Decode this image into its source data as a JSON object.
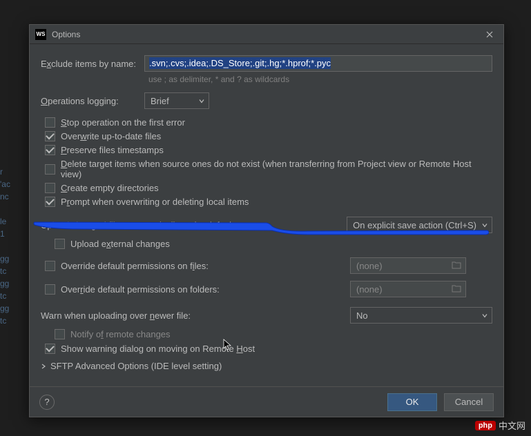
{
  "titlebar": {
    "icon_text": "WS",
    "title": "Options"
  },
  "exclude": {
    "label_pre": "E",
    "label_u": "x",
    "label_post": "clude items by name:",
    "value": ".svn;.cvs;.idea;.DS_Store;.git;.hg;*.hprof;*.pyc",
    "hint": "use ; as delimiter, * and ? as wildcards"
  },
  "operations": {
    "label_pre": "",
    "label_u": "O",
    "label_post": "perations logging:",
    "value": "Brief"
  },
  "checkboxes": {
    "stop_error": {
      "checked": false,
      "pre": "",
      "u": "S",
      "post": "top operation on the first error"
    },
    "overwrite": {
      "checked": true,
      "pre": "Over",
      "u": "w",
      "post": "rite up-to-date files"
    },
    "preserve": {
      "checked": true,
      "pre": "",
      "u": "P",
      "post": "reserve files timestamps"
    },
    "delete_target": {
      "checked": false,
      "pre": "",
      "u": "D",
      "post": "elete target items when source ones do not exist (when transferring from Project view or Remote Host view)"
    },
    "create_empty": {
      "checked": false,
      "pre": "",
      "u": "C",
      "post": "reate empty directories"
    },
    "prompt": {
      "checked": true,
      "pre": "P",
      "u": "r",
      "post": "ompt when overwriting or deleting local items"
    },
    "upload_external": {
      "checked": false,
      "pre": "Upload e",
      "u": "x",
      "post": "ternal changes"
    },
    "override_files": {
      "checked": false,
      "pre": "Override default permissions on f",
      "u": "i",
      "post": "les:"
    },
    "override_folders": {
      "checked": false,
      "pre": "Over",
      "u": "r",
      "post": "ide default permissions on folders:"
    },
    "notify_remote": {
      "checked": false,
      "pre": "Notify o",
      "u": "f",
      "post": " remote changes"
    },
    "show_warning": {
      "checked": true,
      "pre": "Show warning dialog on moving on Remote ",
      "u": "H",
      "post": "ost"
    }
  },
  "upload_auto": {
    "label_pre": "Upload changed files ",
    "label_u": "a",
    "label_post": "utomatically to the default server",
    "value": "On explicit save action (Ctrl+S)"
  },
  "perm_files_value": "(none)",
  "perm_folders_value": "(none)",
  "warn_newer": {
    "label_pre": "Warn when uploading over ",
    "label_u": "n",
    "label_post": "ewer file:",
    "value": "No"
  },
  "sftp_advanced": "SFTP Advanced Options (IDE level setting)",
  "buttons": {
    "help": "?",
    "ok": "OK",
    "cancel": "Cancel"
  },
  "watermark": {
    "badge": "php",
    "text": "中文网"
  }
}
